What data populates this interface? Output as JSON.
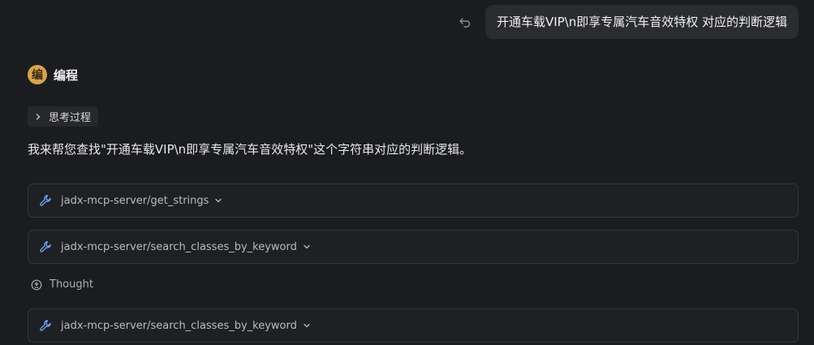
{
  "user_message": {
    "text": "开通车载VIP\\n即享专属汽车音效特权 对应的判断逻辑"
  },
  "assistant": {
    "avatar_char": "编",
    "name": "编程",
    "thinking_label": "思考过程",
    "intro": "我来帮您查找\"开通车载VIP\\n即享专属汽车音效特权\"这个字符串对应的判断逻辑。"
  },
  "tool_calls": [
    {
      "name": "jadx-mcp-server/get_strings"
    },
    {
      "name": "jadx-mcp-server/search_classes_by_keyword"
    },
    {
      "name": "jadx-mcp-server/search_classes_by_keyword"
    }
  ],
  "thought": {
    "label": "Thought"
  },
  "icons": {
    "undo": "undo-icon",
    "chevron_right": "chevron-right-icon",
    "wrench": "wrench-icon",
    "chevron_down": "chevron-down-icon",
    "thought": "lightbulb-icon"
  },
  "colors": {
    "background": "#1b1c1f",
    "bubble": "#2b2c30",
    "avatar": "#d6a350",
    "wrench": "#6ea8ff"
  }
}
